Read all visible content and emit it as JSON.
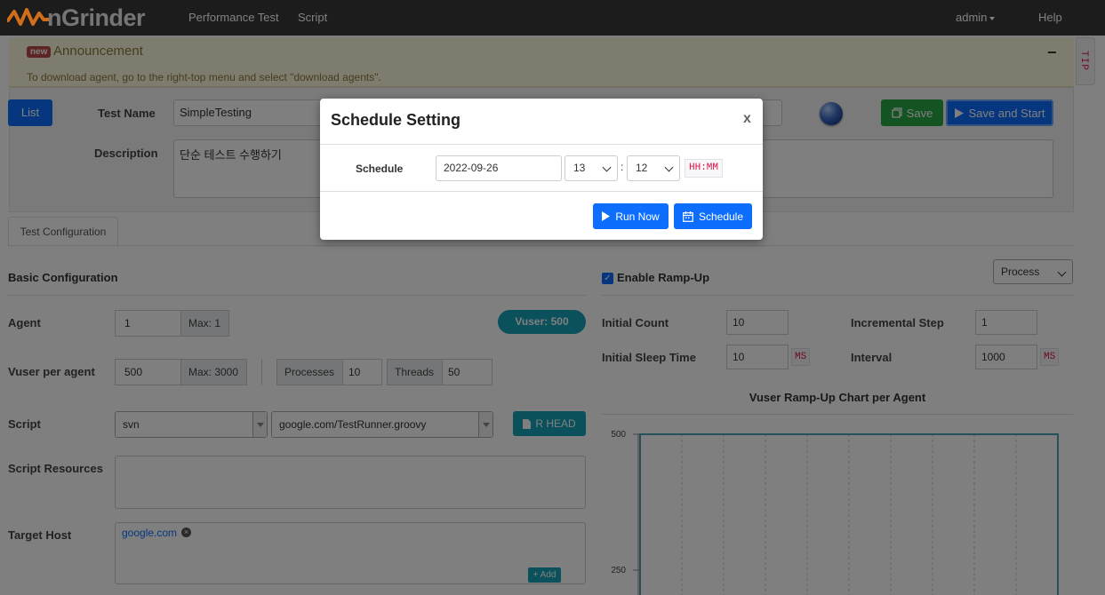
{
  "app": {
    "brand": "nGrinder"
  },
  "nav": {
    "performance_test": "Performance Test",
    "script": "Script",
    "admin": "admin",
    "help": "Help"
  },
  "announcement": {
    "badge": "new",
    "title": "Announcement",
    "collapse": "−",
    "text": "To download agent, go to the right-top menu and select \"download agents\".",
    "tip": "TIP"
  },
  "header": {
    "list_button": "List",
    "test_name_label": "Test Name",
    "test_name_value": "SimpleTesting",
    "description_label": "Description",
    "description_value": "단순 테스트 수행하기",
    "save_button": "Save",
    "save_start_button": "Save and Start"
  },
  "tabs": {
    "test_configuration": "Test Configuration"
  },
  "basic": {
    "title": "Basic Configuration",
    "agent_label": "Agent",
    "agent_value": "1",
    "agent_max": "Max: 1",
    "vuser_badge": "Vuser: 500",
    "vuser_per_agent_label": "Vuser per agent",
    "vuser_value": "500",
    "vuser_max": "Max: 3000",
    "processes_label": "Processes",
    "processes_value": "10",
    "threads_label": "Threads",
    "threads_value": "50",
    "script_label": "Script",
    "script_repo": "svn",
    "script_file": "google.com/TestRunner.groovy",
    "rhead_button": "R HEAD",
    "script_resources_label": "Script Resources",
    "target_host_label": "Target Host",
    "target_host": "google.com",
    "add_button": "Add"
  },
  "rampup": {
    "enable_label": "Enable Ramp-Up",
    "enabled": true,
    "mode": "Process",
    "initial_count_label": "Initial Count",
    "initial_count": "10",
    "incremental_step_label": "Incremental Step",
    "incremental_step": "1",
    "initial_sleep_label": "Initial Sleep Time",
    "initial_sleep": "10",
    "interval_label": "Interval",
    "interval": "1000",
    "ms_unit": "MS"
  },
  "chart_data": {
    "type": "line",
    "title": "Vuser Ramp-Up Chart per Agent",
    "y_ticks": [
      "500",
      "250"
    ],
    "series": [
      {
        "values": [
          500,
          500
        ]
      }
    ],
    "color": "#4aa3b5"
  },
  "modal": {
    "title": "Schedule Setting",
    "close": "x",
    "schedule_label": "Schedule",
    "date": "2022-09-26",
    "hour": "13",
    "minute": "12",
    "separator": ":",
    "format_hint": "HH:MM",
    "run_now_button": "Run Now",
    "schedule_button": "Schedule"
  },
  "colors": {
    "primary": "#0d6efd",
    "success": "#28a745",
    "info": "#17a2b8",
    "navbar": "#222222",
    "logo_orange": "#f58220"
  }
}
